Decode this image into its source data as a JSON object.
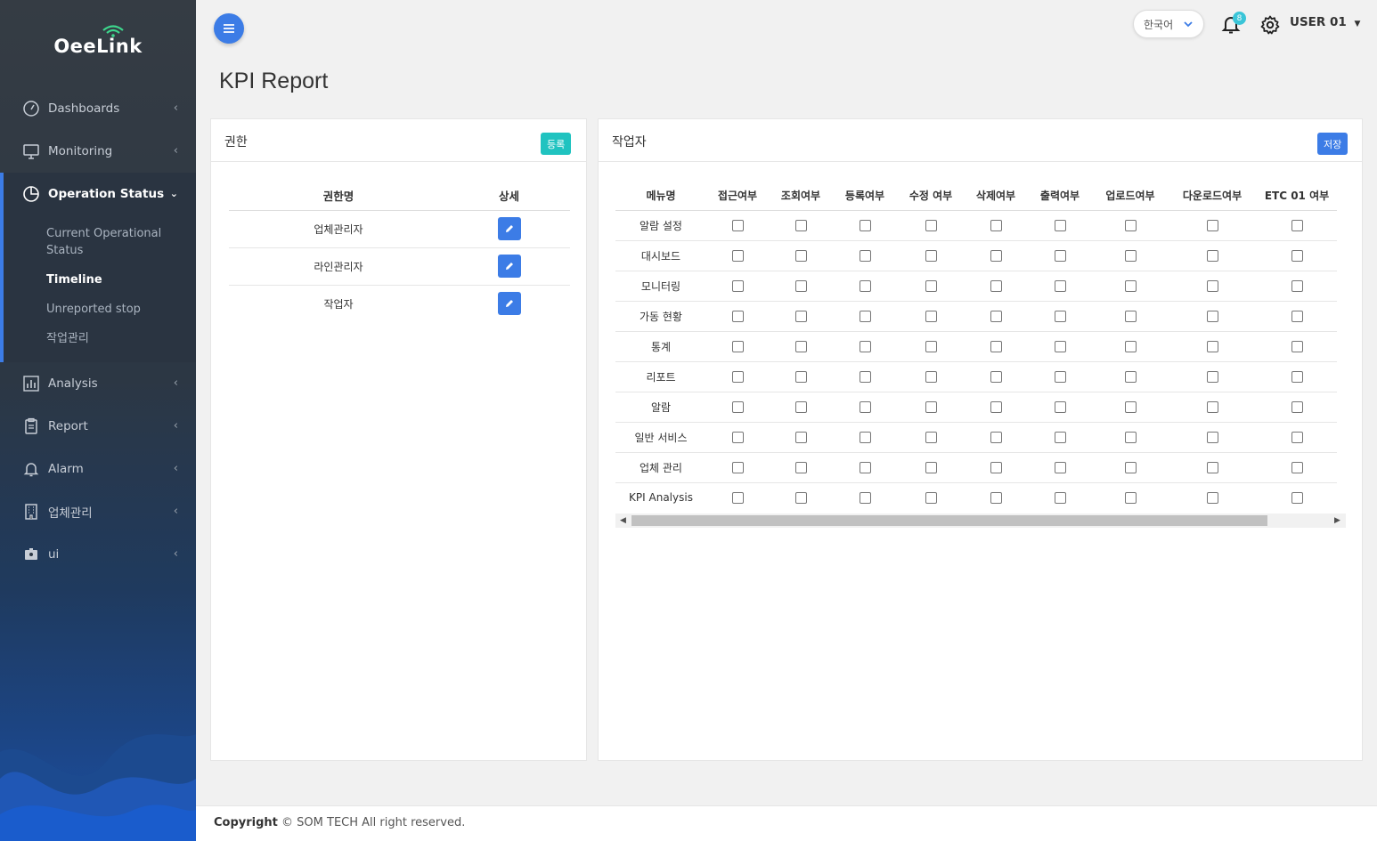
{
  "brand": {
    "name": "OeeLink"
  },
  "sidebar": {
    "items": [
      {
        "label": "Dashboards",
        "icon": "gauge-icon"
      },
      {
        "label": "Monitoring",
        "icon": "monitor-icon"
      },
      {
        "label": "Operation Status",
        "icon": "pie-chart-icon",
        "open": true,
        "sub": [
          "Current Operational Status",
          "Timeline",
          "Unreported stop",
          "작업관리"
        ],
        "active_sub": "Timeline"
      },
      {
        "label": "Analysis",
        "icon": "bar-chart-icon"
      },
      {
        "label": "Report",
        "icon": "clipboard-icon"
      },
      {
        "label": "Alarm",
        "icon": "bell-icon"
      },
      {
        "label": "업체관리",
        "icon": "building-icon"
      },
      {
        "label": "ui",
        "icon": "id-badge-icon"
      }
    ]
  },
  "topbar": {
    "language": "한국어",
    "notification_count": "8",
    "user": "USER 01"
  },
  "page": {
    "title": "KPI Report"
  },
  "roles_card": {
    "title": "권한",
    "register_label": "등록",
    "columns": [
      "권한명",
      "상세"
    ],
    "rows": [
      "업체관리자",
      "라인관리자",
      "작업자"
    ]
  },
  "perm_card": {
    "title": "작업자",
    "save_label": "저장",
    "columns": [
      "메뉴명",
      "접근여부",
      "조회여부",
      "등록여부",
      "수정 여부",
      "삭제여부",
      "출력여부",
      "업로드여부",
      "다운로드여부",
      "ETC 01 여부"
    ],
    "rows": [
      "알람 설정",
      "대시보드",
      "모니터링",
      "가동 현황",
      "통계",
      "리포트",
      "알람",
      "일반 서비스",
      "업체 관리",
      "KPI Analysis"
    ]
  },
  "footer": {
    "bold": "Copyright",
    "text": "© SOM TECH All right reserved."
  },
  "colors": {
    "primary": "#3c7ce6",
    "teal": "#20c3c0",
    "sidebar": "#353c44"
  }
}
